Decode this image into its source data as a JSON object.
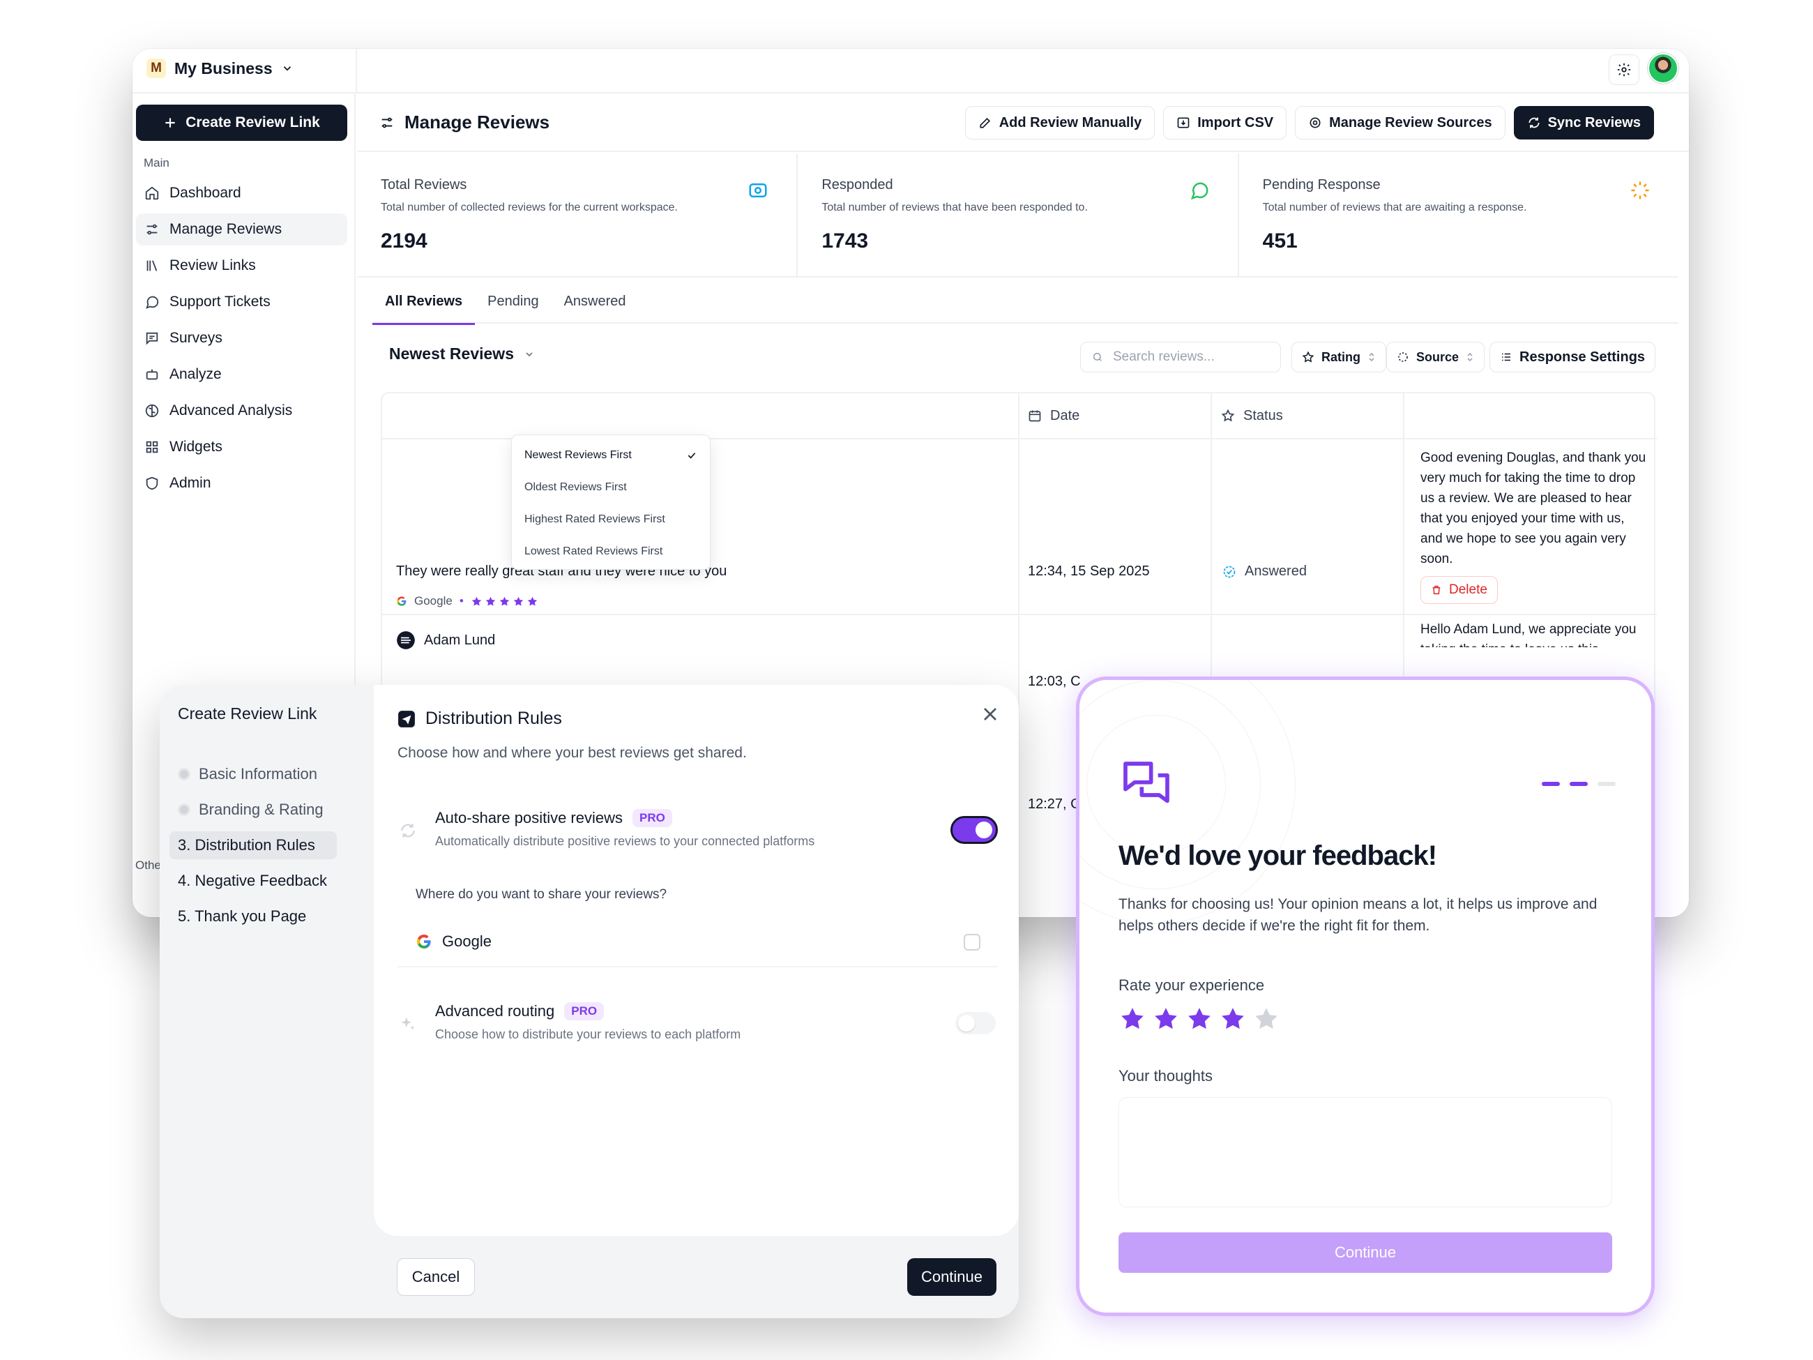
{
  "topbar": {
    "business_initial": "M",
    "business_name": "My Business"
  },
  "sidebar": {
    "create_label": "Create Review Link",
    "section_main": "Main",
    "section_other": "Othe",
    "items": [
      {
        "label": "Dashboard",
        "icon": "home-icon"
      },
      {
        "label": "Manage Reviews",
        "icon": "sliders-icon"
      },
      {
        "label": "Review Links",
        "icon": "library-icon"
      },
      {
        "label": "Support Tickets",
        "icon": "chat-icon"
      },
      {
        "label": "Surveys",
        "icon": "message-square-icon"
      },
      {
        "label": "Analyze",
        "icon": "bot-icon"
      },
      {
        "label": "Advanced Analysis",
        "icon": "brain-icon"
      },
      {
        "label": "Widgets",
        "icon": "grid-icon"
      },
      {
        "label": "Admin",
        "icon": "shield-icon"
      }
    ]
  },
  "page": {
    "title": "Manage Reviews",
    "buttons": {
      "add_manual": "Add Review Manually",
      "import_csv": "Import CSV",
      "manage_sources": "Manage Review Sources",
      "sync": "Sync Reviews"
    }
  },
  "stats": [
    {
      "label": "Total Reviews",
      "desc": "Total number of collected reviews for the current workspace.",
      "value": "2194",
      "icon": "eye-icon",
      "color": "#0ea5e9"
    },
    {
      "label": "Responded",
      "desc": "Total number of reviews that have been responded to.",
      "value": "1743",
      "icon": "message-circle-icon",
      "color": "#22c55e"
    },
    {
      "label": "Pending Response",
      "desc": "Total number of reviews that are awaiting a response.",
      "value": "451",
      "icon": "loader-icon",
      "color": "#f59e0b"
    }
  ],
  "tabs": [
    "All Reviews",
    "Pending",
    "Answered"
  ],
  "filters": {
    "sort_label": "Newest Reviews",
    "search_placeholder": "Search reviews...",
    "rating": "Rating",
    "source": "Source",
    "response_settings": "Response Settings"
  },
  "sort_options": [
    "Newest Reviews First",
    "Oldest Reviews First",
    "Highest Rated Reviews First",
    "Lowest Rated Reviews First"
  ],
  "table": {
    "headers": {
      "date": "Date",
      "status": "Status"
    },
    "rows": [
      {
        "text": "They were really great staff and they were nice to you",
        "source": "Google",
        "rating": 5,
        "date": "12:34, 15 Sep 2025",
        "status": "Answered",
        "reply": "Good evening Douglas, and thank you very much for taking the time to drop us a review. We are pleased to hear that you enjoyed your time with us, and we hope to see you again very soon.",
        "delete": "Delete"
      },
      {
        "reviewer": "Adam Lund",
        "date": "12:03, C",
        "reply": "Hello Adam Lund, we appreciate you taking the time to leave us this"
      },
      {
        "date": "12:27, C"
      }
    ]
  },
  "modal": {
    "title": "Create Review Link",
    "steps": [
      {
        "label": "Basic Information"
      },
      {
        "label": "Branding & Rating"
      },
      {
        "label": "3. Distribution Rules"
      },
      {
        "label": "4. Negative Feedback"
      },
      {
        "label": "5. Thank you Page"
      }
    ],
    "panel_title": "Distribution Rules",
    "panel_subtitle": "Choose how and where your best reviews get shared.",
    "auto_share": {
      "title": "Auto-share positive reviews",
      "badge": "PRO",
      "desc": "Automatically distribute positive reviews to your connected platforms",
      "enabled": true
    },
    "share_question": "Where do you want to share your reviews?",
    "google_label": "Google",
    "routing": {
      "title": "Advanced routing",
      "badge": "PRO",
      "desc": "Choose how to distribute your reviews to each platform",
      "enabled": false
    },
    "cancel": "Cancel",
    "continue": "Continue"
  },
  "feedback": {
    "title": "We'd love your feedback!",
    "subtitle": "Thanks for choosing us! Your opinion means a lot, it helps us improve and helps others decide if we're the right fit for them.",
    "rate_label": "Rate your experience",
    "rating": 4,
    "max_rating": 5,
    "thoughts_label": "Your thoughts",
    "continue": "Continue",
    "accent": "#7c3aed"
  }
}
